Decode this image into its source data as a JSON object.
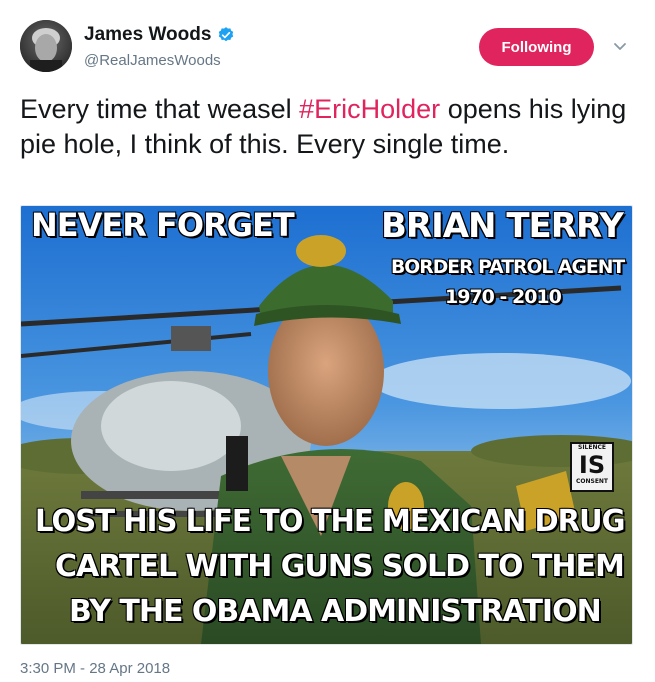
{
  "author": {
    "display_name": "James Woods",
    "handle": "@RealJamesWoods",
    "verified": true
  },
  "actions": {
    "follow_label": "Following",
    "more_icon": "chevron-down-icon"
  },
  "tweet": {
    "text_before": "Every time that weasel ",
    "hashtag": "#EricHolder",
    "text_after": " opens his lying pie hole, I think of this. Every single time.",
    "timestamp": "3:30 PM - 28 Apr 2018"
  },
  "media": {
    "top_left": "NEVER FORGET",
    "name": "BRIAN TERRY",
    "role": "BORDER PATROL AGENT",
    "years": "1970 - 2010",
    "badge_top": "SILENCE",
    "badge_mid": "IS",
    "badge_bottom": "CONSENT",
    "caption_line1": "LOST HIS LIFE TO THE MEXICAN DRUG",
    "caption_line2": "CARTEL WITH GUNS SOLD TO THEM",
    "caption_line3": "BY THE OBAMA ADMINISTRATION"
  },
  "colors": {
    "accent": "#e0245e",
    "verified": "#1da1f2",
    "secondary_text": "#657786"
  }
}
